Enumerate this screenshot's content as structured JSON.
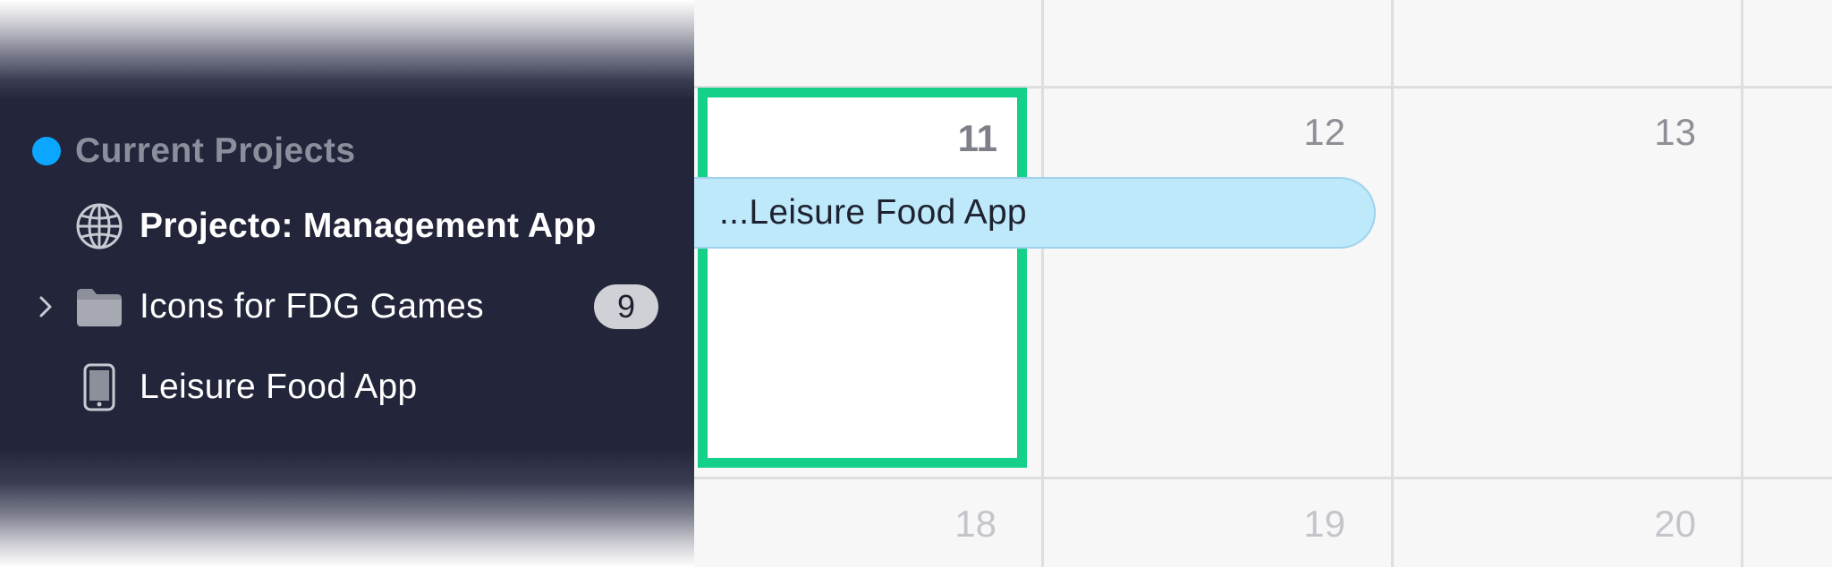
{
  "sidebar": {
    "group": {
      "label": "Current Projects",
      "dot_color": "#0aa6ff"
    },
    "items": [
      {
        "label": "Projecto: Management App",
        "icon": "globe-icon",
        "expandable": false
      },
      {
        "label": "Icons for FDG Games",
        "icon": "folder-icon",
        "expandable": true,
        "count": "9"
      },
      {
        "label": "Leisure Food App",
        "icon": "phone-icon",
        "expandable": false
      }
    ]
  },
  "calendar": {
    "today_accent": "#14d089",
    "week1": [
      "11",
      "12",
      "13"
    ],
    "week2": [
      "18",
      "19",
      "20"
    ],
    "event": {
      "label": "...Leisure Food App",
      "color": "#bde9fb"
    }
  }
}
